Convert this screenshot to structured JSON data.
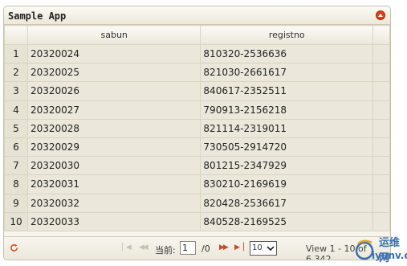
{
  "grid": {
    "caption": "Sample App",
    "columns": [
      "sabun",
      "registno"
    ],
    "rows": [
      {
        "rn": "1",
        "sabun": "20320024",
        "registno": "810320-2536636"
      },
      {
        "rn": "2",
        "sabun": "20320025",
        "registno": "821030-2661617"
      },
      {
        "rn": "3",
        "sabun": "20320026",
        "registno": "840617-2352511"
      },
      {
        "rn": "4",
        "sabun": "20320027",
        "registno": "790913-2156218"
      },
      {
        "rn": "5",
        "sabun": "20320028",
        "registno": "821114-2319011"
      },
      {
        "rn": "6",
        "sabun": "20320029",
        "registno": "730505-2914720"
      },
      {
        "rn": "7",
        "sabun": "20320030",
        "registno": "801215-2347929"
      },
      {
        "rn": "8",
        "sabun": "20320031",
        "registno": "830210-2169619"
      },
      {
        "rn": "9",
        "sabun": "20320032",
        "registno": "820428-2536617"
      },
      {
        "rn": "10",
        "sabun": "20320033",
        "registno": "840528-2169525"
      }
    ]
  },
  "pager": {
    "page_label": "当前:",
    "page_value": "1",
    "page_total": "/0",
    "rows_per_page": "10",
    "view_info": "View 1 - 10 of 6,342",
    "nav_icons": {
      "first": "first-page-icon",
      "prev": "prev-page-icon",
      "next": "next-page-icon",
      "last": "last-page-icon"
    }
  },
  "watermark": {
    "line1": "运维网",
    "line2": "iyunv.com"
  },
  "colors": {
    "header_bg": "#ebe7da",
    "cell_bg": "#ebe7da",
    "accent": "#d9401a",
    "watermark": "#3a6fb0"
  }
}
